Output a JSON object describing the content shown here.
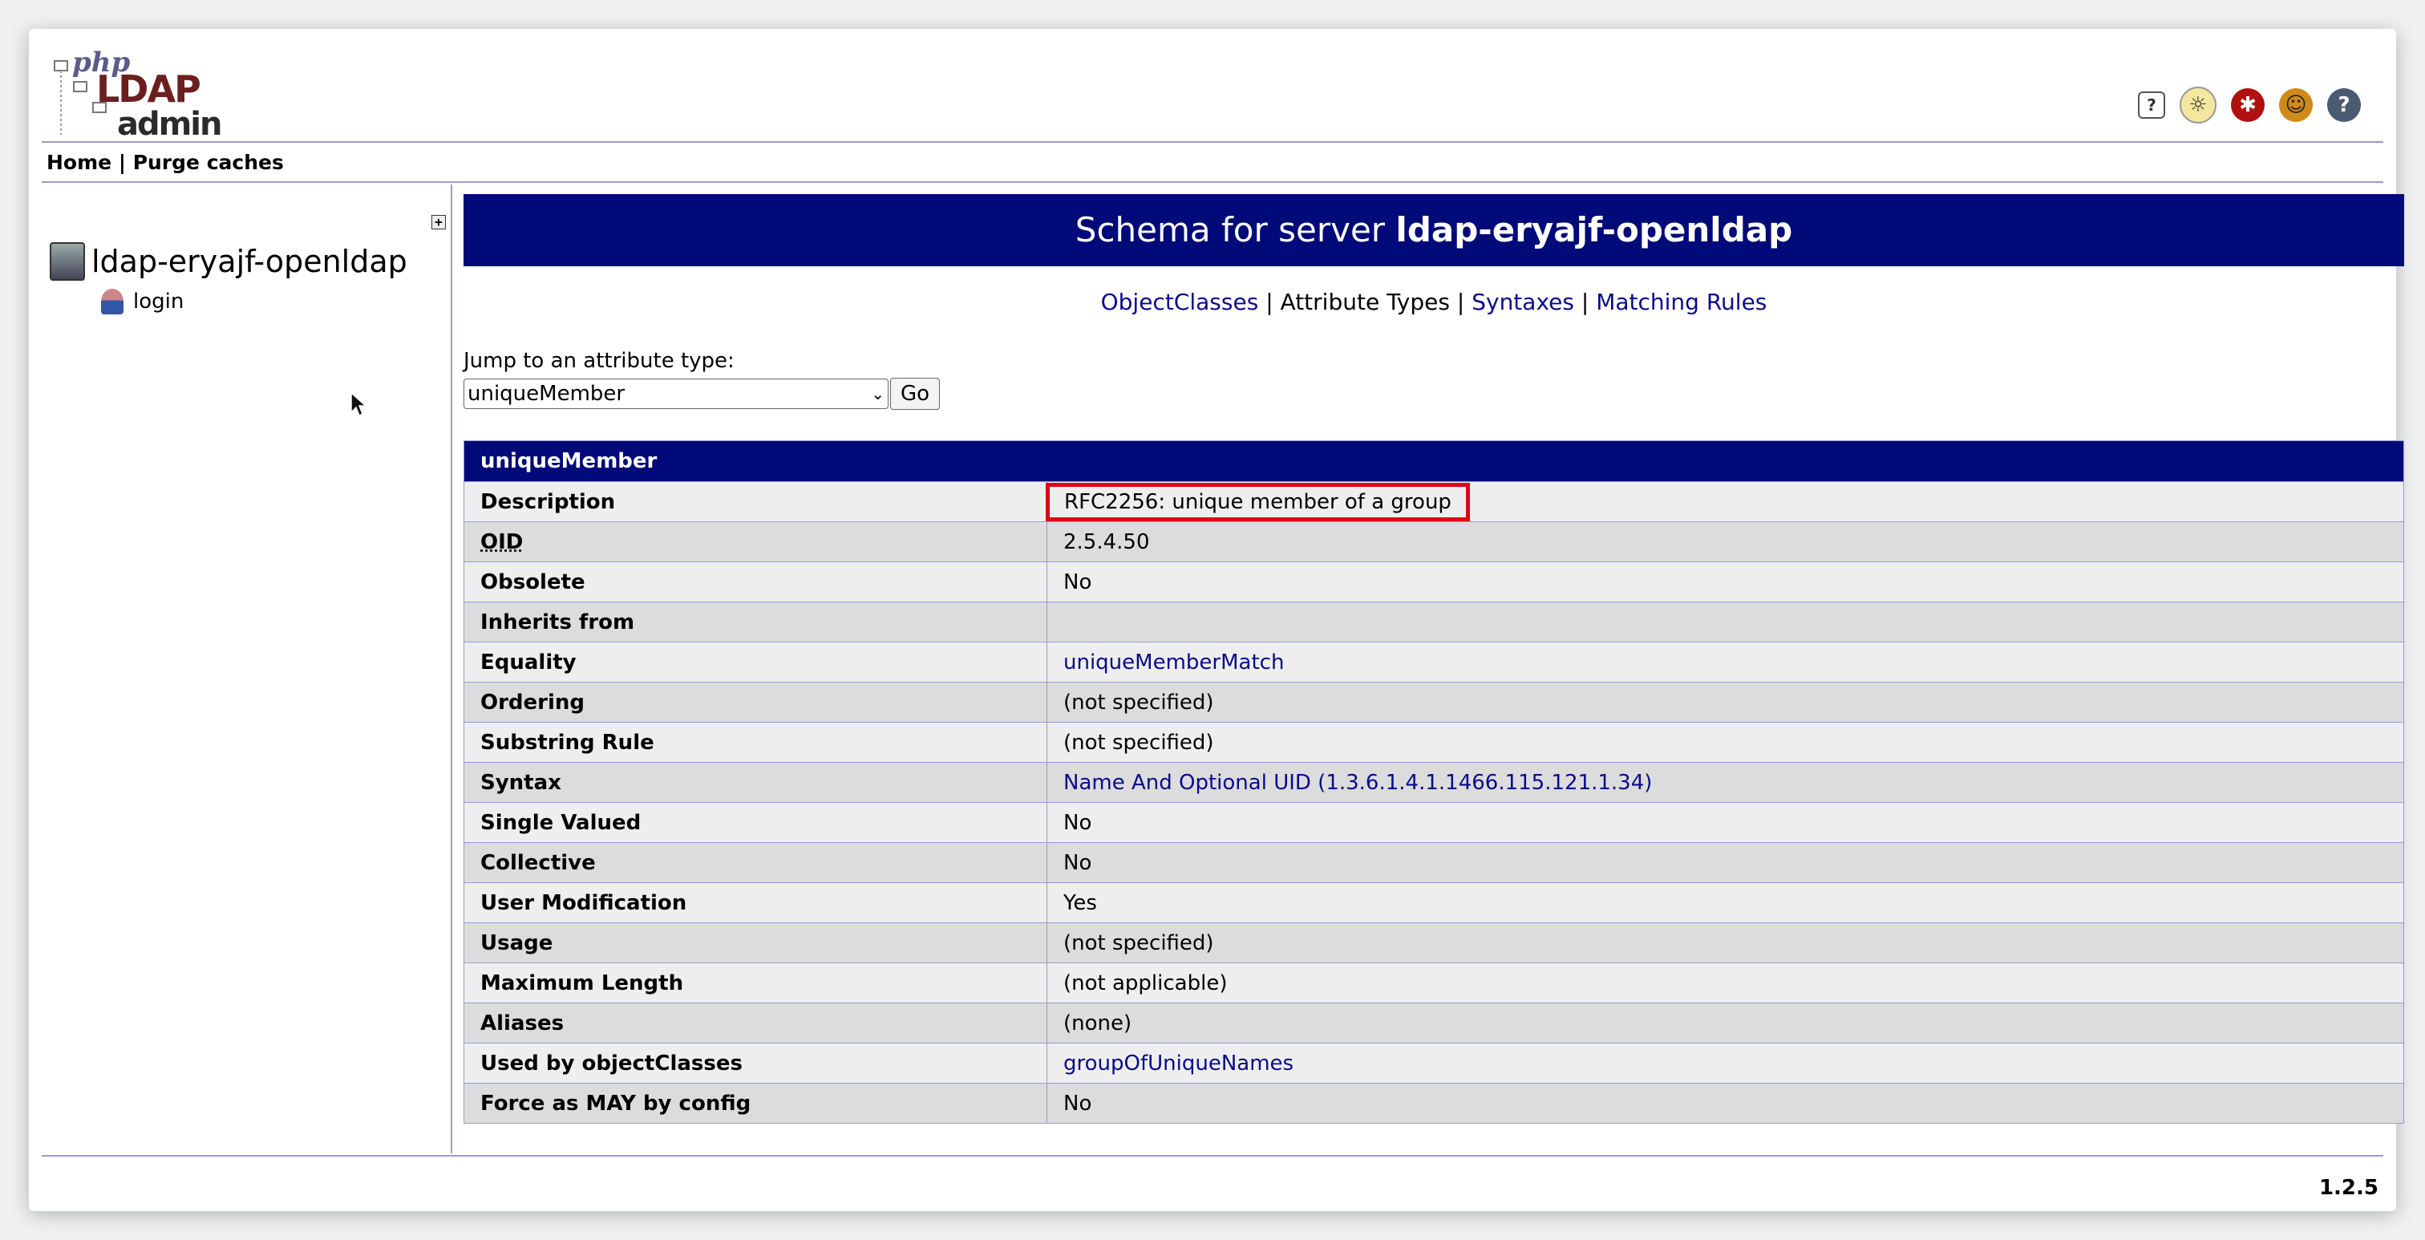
{
  "logo": {
    "php": "php",
    "ldap": "LDAP",
    "admin": "admin"
  },
  "header_icons": [
    "help-icon",
    "lightbulb-icon",
    "bug-icon",
    "smiley-icon",
    "question-icon"
  ],
  "nav": {
    "home": "Home",
    "separator": "|",
    "purge": "Purge caches"
  },
  "sidebar": {
    "server_name": "ldap-eryajf-openldap",
    "login_label": "login",
    "expand_symbol": "+"
  },
  "main": {
    "title_prefix": "Schema for server ",
    "title_server": "ldap-eryajf-openldap",
    "tabs": [
      {
        "label": "ObjectClasses"
      },
      {
        "label": "Attribute Types"
      },
      {
        "label": "Syntaxes"
      },
      {
        "label": "Matching Rules"
      }
    ],
    "tab_sep": "|",
    "jump_label": "Jump to an attribute type:",
    "jump_value": "uniqueMember",
    "go_label": "Go",
    "attribute_name": "uniqueMember",
    "rows": [
      {
        "key": "Description",
        "value": "RFC2256: unique member of a group",
        "link": false
      },
      {
        "key": "OID",
        "value": "2.5.4.50",
        "link": false
      },
      {
        "key": "Obsolete",
        "value": "No",
        "link": false
      },
      {
        "key": "Inherits from",
        "value": "",
        "link": false
      },
      {
        "key": "Equality",
        "value": "uniqueMemberMatch",
        "link": true
      },
      {
        "key": "Ordering",
        "value": "(not specified)",
        "link": false
      },
      {
        "key": "Substring Rule",
        "value": "(not specified)",
        "link": false
      },
      {
        "key": "Syntax",
        "value": "Name And Optional UID (1.3.6.1.4.1.1466.115.121.1.34)",
        "link": true
      },
      {
        "key": "Single Valued",
        "value": "No",
        "link": false
      },
      {
        "key": "Collective",
        "value": "No",
        "link": false
      },
      {
        "key": "User Modification",
        "value": "Yes",
        "link": false
      },
      {
        "key": "Usage",
        "value": "(not specified)",
        "link": false
      },
      {
        "key": "Maximum Length",
        "value": "(not applicable)",
        "link": false
      },
      {
        "key": "Aliases",
        "value": "(none)",
        "link": false
      },
      {
        "key": "Used by objectClasses",
        "value": "groupOfUniqueNames",
        "link": true
      },
      {
        "key": "Force as MAY by config",
        "value": "No",
        "link": false
      }
    ]
  },
  "footer": {
    "version": "1.2.5"
  },
  "colors": {
    "header_bg": "#000a78",
    "link": "#0a0a8a",
    "highlight": "#e0001a"
  }
}
